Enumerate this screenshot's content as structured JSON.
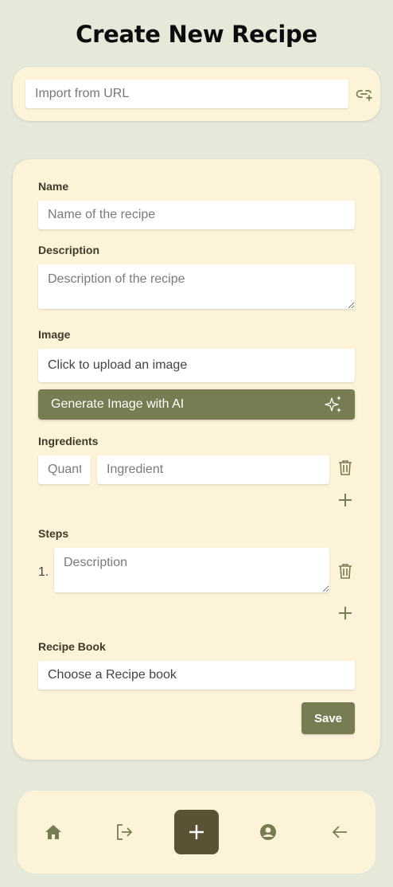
{
  "header": {
    "title": "Create New Recipe"
  },
  "import": {
    "placeholder": "Import from URL",
    "link_icon": "link-plus-icon"
  },
  "form": {
    "name": {
      "label": "Name",
      "placeholder": "Name of the recipe"
    },
    "description": {
      "label": "Description",
      "placeholder": "Description of the recipe"
    },
    "image": {
      "label": "Image",
      "upload_text": "Click to upload an image",
      "generate_label": "Generate Image with AI",
      "generate_icon": "sparkles-icon"
    },
    "ingredients": {
      "label": "Ingredients",
      "quantity_placeholder": "Quantity",
      "ingredient_placeholder": "Ingredient"
    },
    "steps": {
      "label": "Steps",
      "step_number": "1.",
      "step_placeholder": "Description"
    },
    "recipe_book": {
      "label": "Recipe Book",
      "placeholder": "Choose a Recipe book"
    },
    "save_label": "Save"
  },
  "nav": {
    "items": [
      "home-icon",
      "logout-icon",
      "plus-icon",
      "account-circle-icon",
      "arrow-left-icon"
    ]
  },
  "colors": {
    "accent": "#787c52",
    "card": "#fcf3d9",
    "background": "#e6e9da",
    "nav_active": "#5b5135"
  }
}
